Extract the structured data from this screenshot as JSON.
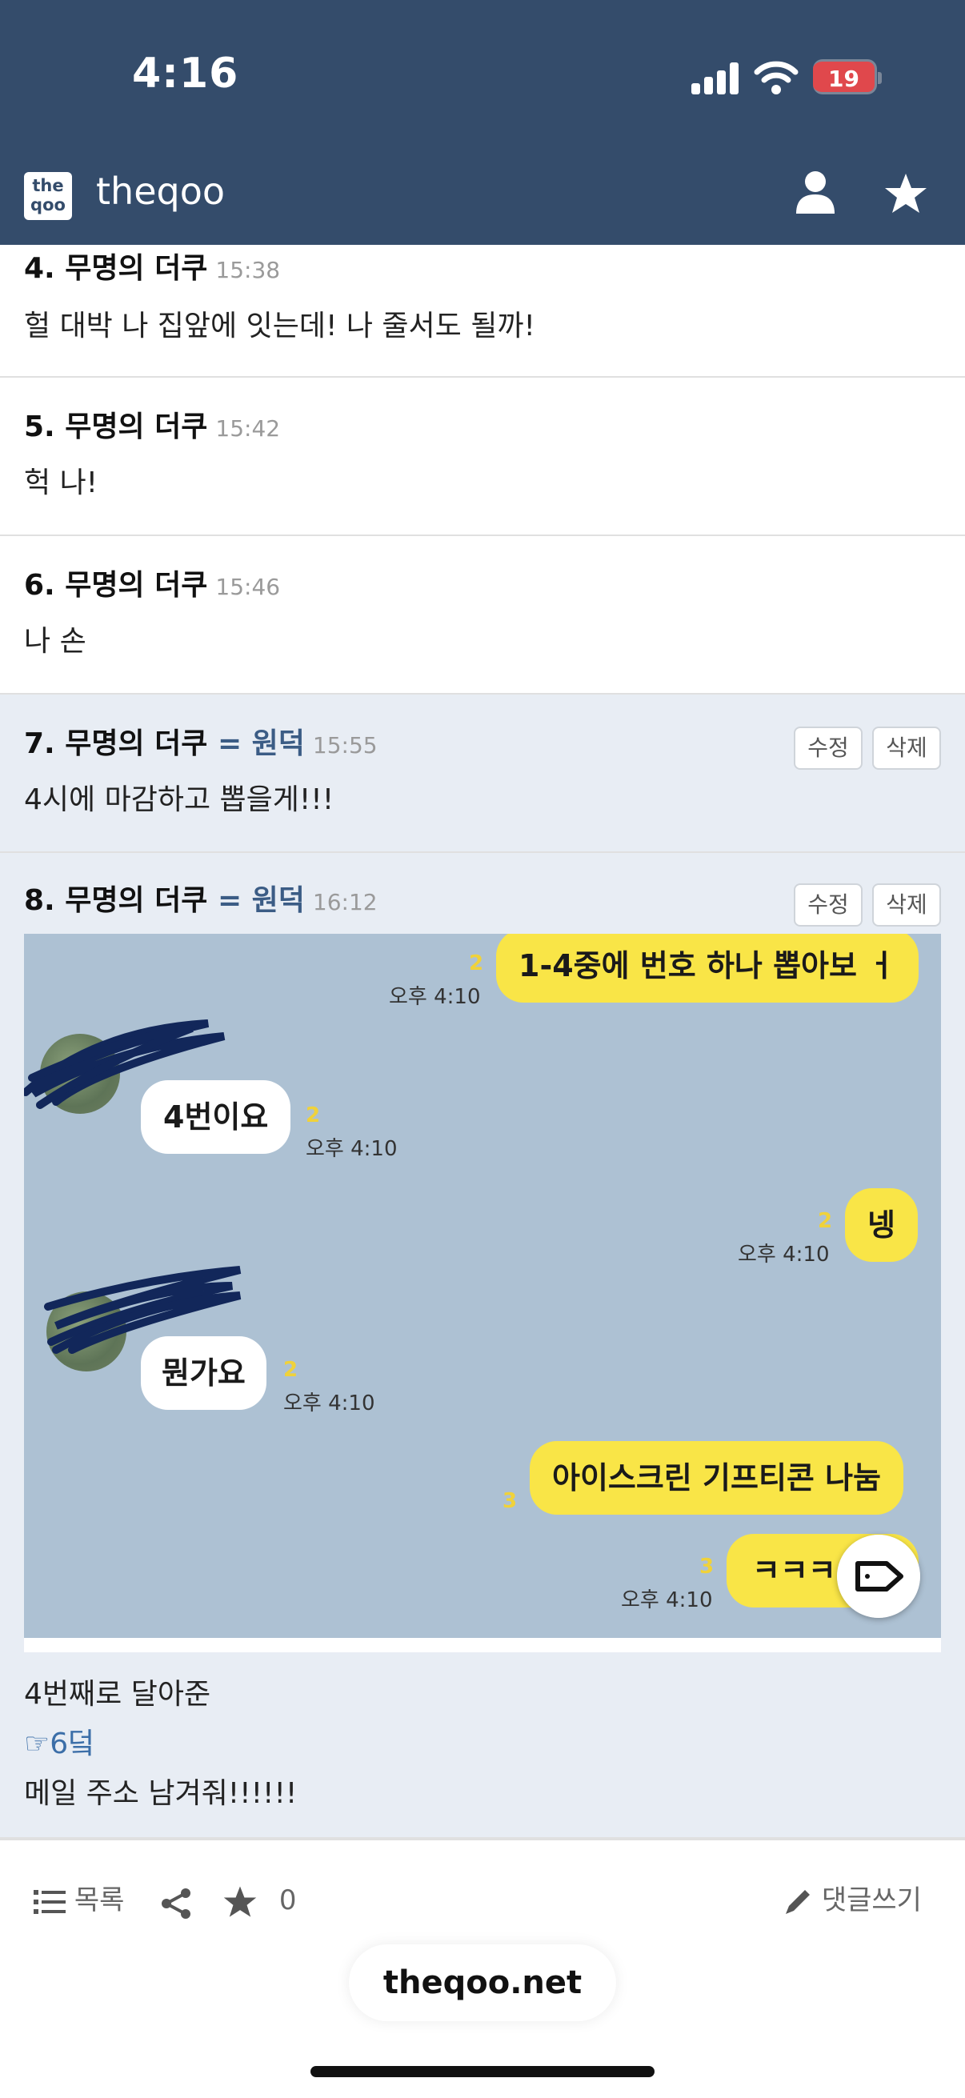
{
  "status_bar": {
    "time": "4:16",
    "battery": "19"
  },
  "header": {
    "logo_text_top": "the",
    "logo_text_bottom": "qoo",
    "title": "theqoo"
  },
  "comments": [
    {
      "num": "4.",
      "author": "무명의 더쿠",
      "time": "15:38",
      "text": "헐 대박 나 집앞에 잇는데! 나 줄서도 될까!"
    },
    {
      "num": "5.",
      "author": "무명의 더쿠",
      "time": "15:42",
      "text": "헉 나!"
    },
    {
      "num": "6.",
      "author": "무명의 더쿠",
      "time": "15:46",
      "text": "나 손"
    },
    {
      "num": "7.",
      "author": "무명의 더쿠",
      "alias": "= 원덕",
      "time": "15:55",
      "text": "4시에 마감하고 뽑을게!!!",
      "edit": "수정",
      "delete": "삭제"
    },
    {
      "num": "8.",
      "author": "무명의 더쿠",
      "alias": "= 원덕",
      "time": "16:12",
      "edit": "수정",
      "delete": "삭제",
      "lines": [
        "4번째로 달아준",
        "☞6덬",
        "메일 주소 남겨줘!!!!!!"
      ]
    }
  ],
  "chat": {
    "messages": [
      {
        "side": "right",
        "text": "1-4중에 번호 하나 뽑아보 ㅓ",
        "read": "2",
        "time": "오후 4:10"
      },
      {
        "side": "left",
        "text": "4번이요",
        "read": "2",
        "time": "오후 4:10"
      },
      {
        "side": "right",
        "text": "넹",
        "read": "2",
        "time": "오후 4:10"
      },
      {
        "side": "left",
        "text": "뭔가요",
        "read": "2",
        "time": "오후 4:10"
      },
      {
        "side": "right",
        "text": "아이스크린 기프티콘 나눔",
        "read": "3",
        "time": ""
      },
      {
        "side": "right",
        "text": "ㅋㅋㅋ",
        "read": "3",
        "time": "오후 4:10"
      }
    ]
  },
  "footer": {
    "list_label": "목록",
    "star_count": "0",
    "write_label": "댓글쓰기"
  },
  "browser": {
    "domain": "theqoo.net"
  },
  "colors": {
    "header_bg": "#344c6b",
    "alias": "#3b5c85",
    "reply_link": "#3b6ea8",
    "chat_bg": "#adc1d3",
    "bubble_yellow": "#f9e547",
    "read_count": "#f0d23a"
  }
}
